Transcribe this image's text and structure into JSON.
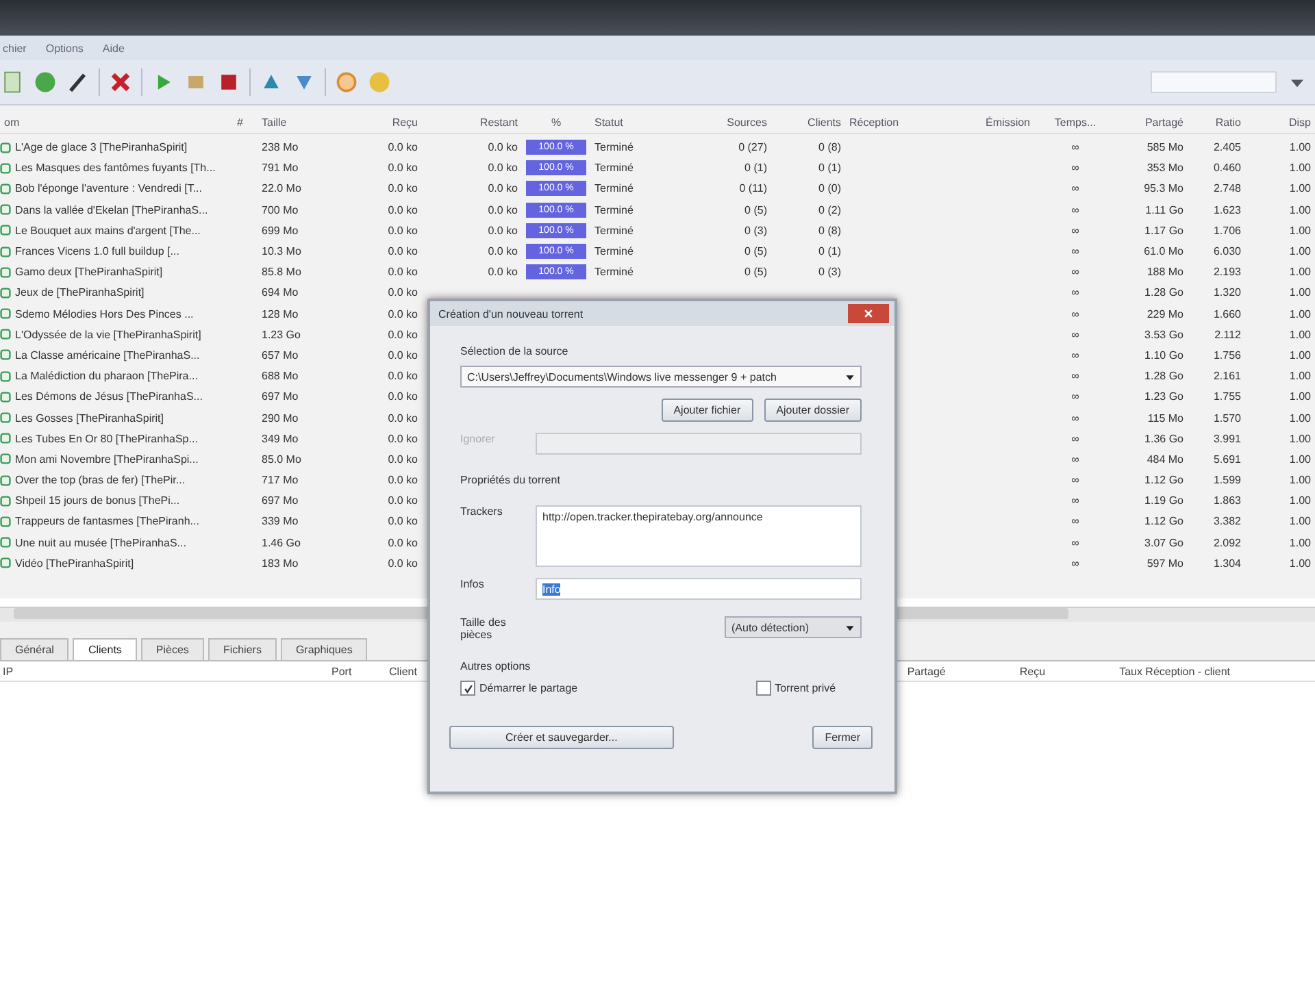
{
  "menu": [
    "chier",
    "Options",
    "Aide"
  ],
  "columns": [
    "om",
    "#",
    "Taille",
    "Reçu",
    "Restant",
    "%",
    "Statut",
    "Sources",
    "Clients",
    "Réception",
    "Émission",
    "Temps...",
    "Partagé",
    "Ratio",
    "Disp"
  ],
  "rows": [
    {
      "name": "L'Age de glace 3 [ThePiranhaSpirit]",
      "size": "238 Mo",
      "received": "0.0 ko",
      "remaining": "0.0 ko",
      "progress": {
        "text": "100.0 %",
        "level": 1
      },
      "status": "Terminé",
      "sources": "0 (27)",
      "clients": "0 (8)",
      "time": "∞",
      "shared": "585 Mo",
      "ratio": "2.405",
      "avail": "1.00"
    },
    {
      "name": "Les Masques des fantômes fuyants [Th...",
      "size": "791 Mo",
      "received": "0.0 ko",
      "remaining": "0.0 ko",
      "progress": {
        "text": "100.0 %",
        "level": 1
      },
      "status": "Terminé",
      "sources": "0 (1)",
      "clients": "0 (1)",
      "time": "∞",
      "shared": "353 Mo",
      "ratio": "0.460",
      "avail": "1.00"
    },
    {
      "name": "Bob l'éponge l'aventure : Vendredi [T...",
      "size": "22.0 Mo",
      "received": "0.0 ko",
      "remaining": "0.0 ko",
      "progress": {
        "text": "100.0 %",
        "level": 1
      },
      "status": "Terminé",
      "sources": "0 (11)",
      "clients": "0 (0)",
      "time": "∞",
      "shared": "95.3 Mo",
      "ratio": "2.748",
      "avail": "1.00"
    },
    {
      "name": "Dans la vallée d'Ekelan [ThePiranhaS...",
      "size": "700 Mo",
      "received": "0.0 ko",
      "remaining": "0.0 ko",
      "progress": {
        "text": "100.0 %",
        "level": 1
      },
      "status": "Terminé",
      "sources": "0 (5)",
      "clients": "0 (2)",
      "time": "∞",
      "shared": "1.11 Go",
      "ratio": "1.623",
      "avail": "1.00"
    },
    {
      "name": "Le Bouquet aux mains d'argent [The...",
      "size": "699 Mo",
      "received": "0.0 ko",
      "remaining": "0.0 ko",
      "progress": {
        "text": "100.0 %",
        "level": 1
      },
      "status": "Terminé",
      "sources": "0 (3)",
      "clients": "0 (8)",
      "time": "∞",
      "shared": "1.17 Go",
      "ratio": "1.706",
      "avail": "1.00"
    },
    {
      "name": "Frances Vicens 1.0 full buildup [...",
      "size": "10.3 Mo",
      "received": "0.0 ko",
      "remaining": "0.0 ko",
      "progress": {
        "text": "100.0 %",
        "level": 1
      },
      "status": "Terminé",
      "sources": "0 (5)",
      "clients": "0 (1)",
      "time": "∞",
      "shared": "61.0 Mo",
      "ratio": "6.030",
      "avail": "1.00"
    },
    {
      "name": "Gamo deux [ThePiranhaSpirit]",
      "size": "85.8 Mo",
      "received": "0.0 ko",
      "remaining": "0.0 ko",
      "progress": {
        "text": "100.0 %",
        "level": 1
      },
      "status": "Terminé",
      "sources": "0 (5)",
      "clients": "0 (3)",
      "time": "∞",
      "shared": "188 Mo",
      "ratio": "2.193",
      "avail": "1.00"
    },
    {
      "name": "Jeux de [ThePiranhaSpirit]",
      "size": "694 Mo",
      "received": "0.0 ko",
      "time": "∞",
      "shared": "1.28 Go",
      "ratio": "1.320",
      "avail": "1.00"
    },
    {
      "name": "Sdemo Mélodies Hors Des Pinces ...",
      "size": "128 Mo",
      "received": "0.0 ko",
      "time": "∞",
      "shared": "229 Mo",
      "ratio": "1.660",
      "avail": "1.00"
    },
    {
      "name": "L'Odyssée de la vie [ThePiranhaSpirit]",
      "size": "1.23 Go",
      "received": "0.0 ko",
      "time": "∞",
      "shared": "3.53 Go",
      "ratio": "2.112",
      "avail": "1.00"
    },
    {
      "name": "La Classe américaine [ThePiranhaS...",
      "size": "657 Mo",
      "received": "0.0 ko",
      "time": "∞",
      "shared": "1.10 Go",
      "ratio": "1.756",
      "avail": "1.00"
    },
    {
      "name": "La Malédiction du pharaon [ThePira...",
      "size": "688 Mo",
      "received": "0.0 ko",
      "time": "∞",
      "shared": "1.28 Go",
      "ratio": "2.161",
      "avail": "1.00"
    },
    {
      "name": "Les Démons de Jésus [ThePiranhaS...",
      "size": "697 Mo",
      "received": "0.0 ko",
      "time": "∞",
      "shared": "1.23 Go",
      "ratio": "1.755",
      "avail": "1.00"
    },
    {
      "name": "Les Gosses [ThePiranhaSpirit]",
      "size": "290 Mo",
      "received": "0.0 ko",
      "time": "∞",
      "shared": "115 Mo",
      "ratio": "1.570",
      "avail": "1.00"
    },
    {
      "name": "Les Tubes En Or 80 [ThePiranhaSp...",
      "size": "349 Mo",
      "received": "0.0 ko",
      "time": "∞",
      "shared": "1.36 Go",
      "ratio": "3.991",
      "avail": "1.00"
    },
    {
      "name": "Mon ami Novembre [ThePiranhaSpi...",
      "size": "85.0 Mo",
      "received": "0.0 ko",
      "time": "∞",
      "shared": "484 Mo",
      "ratio": "5.691",
      "avail": "1.00"
    },
    {
      "name": "Over the top (bras de fer) [ThePir...",
      "size": "717 Mo",
      "received": "0.0 ko",
      "time": "∞",
      "shared": "1.12 Go",
      "ratio": "1.599",
      "avail": "1.00"
    },
    {
      "name": "Shpeil 15 jours de bonus [ThePi...",
      "size": "697 Mo",
      "received": "0.0 ko",
      "time": "∞",
      "shared": "1.19 Go",
      "ratio": "1.863",
      "avail": "1.00"
    },
    {
      "name": "Trappeurs de fantasmes [ThePiranh...",
      "size": "339 Mo",
      "received": "0.0 ko",
      "time": "∞",
      "shared": "1.12 Go",
      "ratio": "3.382",
      "avail": "1.00"
    },
    {
      "name": "Une nuit au musée [ThePiranhaS...",
      "size": "1.46 Go",
      "received": "0.0 ko",
      "time": "∞",
      "shared": "3.07 Go",
      "ratio": "2.092",
      "avail": "1.00"
    },
    {
      "name": "Vidéo [ThePiranhaSpirit]",
      "size": "183 Mo",
      "received": "0.0 ko",
      "time": "∞",
      "shared": "597 Mo",
      "ratio": "1.304",
      "avail": "1.00"
    }
  ],
  "detail_tabs": [
    {
      "label": "Général",
      "selected": false
    },
    {
      "label": "Clients",
      "selected": true
    },
    {
      "label": "Pièces",
      "selected": false
    },
    {
      "label": "Fichiers",
      "selected": false
    },
    {
      "label": "Graphiques",
      "selected": false
    }
  ],
  "detail_columns_left": [
    "IP",
    "Port",
    "Client"
  ],
  "detail_columns_right": [
    "Partagé",
    "Reçu",
    "Taux Réception - client"
  ],
  "dialog": {
    "title": "Création d'un nouveau torrent",
    "source_label": "Sélection de la source",
    "source_value": "C:\\Users\\Jeffrey\\Documents\\Windows live messenger 9 + patch",
    "add_file": "Ajouter fichier",
    "add_folder": "Ajouter dossier",
    "skip_label": "Ignorer",
    "properties_label": "Propriétés du torrent",
    "trackers_label": "Trackers",
    "trackers_value": "http://open.tracker.thepiratebay.org/announce",
    "info_label": "Infos",
    "info_value": "Info",
    "piece_label": "Taille des pièces",
    "piece_value": "(Auto détection)",
    "other_label": "Autres options",
    "options": [
      {
        "label": "Démarrer le partage",
        "checked": true
      },
      {
        "label": "Torrent privé",
        "checked": false
      }
    ],
    "create": "Créer et sauvegarder...",
    "close": "Fermer"
  }
}
